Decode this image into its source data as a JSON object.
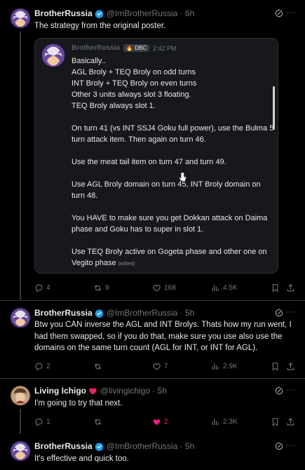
{
  "colors": {
    "background": "#000000",
    "text": "#e7e9ea",
    "muted": "#71767b",
    "verified": "#1d9bf0",
    "like_active": "#f91880",
    "card": "#16181c",
    "border": "#2f3336"
  },
  "tweets": [
    {
      "name": "BrotherRussia",
      "handle": "@ImBrotherRussia · 6h",
      "text": "The strategy from the original poster.",
      "quote": {
        "name": "BrotherRussia",
        "badge": "🔥 DBC",
        "time": "2:42 PM",
        "lines": [
          "Basically..",
          "AGL Broly + TEQ Broly on odd turns",
          "INT Broly + TEQ Broly on even turns",
          "Other 3 units always slot 3 floating.",
          "TEQ Broly always slot 1."
        ],
        "paragraphs": [
          "On turn 41 (vs INT SSJ4 Goku full power), use the Bulma 5 turn attack item. Then again on turn 46.",
          "Use the meat tail item on turn 47 and turn 49.",
          "Use AGL Broly domain on turn 45, INT Broly domain on turn 48.",
          "You HAVE to make sure you get Dokkan attack on Daima phase and Goku has to super in slot 1.",
          "Use TEQ Broly active on Gogeta phase and other one on Vegito phase"
        ],
        "edited": "(edited)"
      },
      "stats": {
        "replies": "4",
        "reposts": "9",
        "likes": "168",
        "views": "4.5K"
      }
    },
    {
      "name": "BrotherRussia",
      "handle": "@ImBrotherRussia · 5h",
      "text": "Btw you CAN inverse the AGL and INT Brolys. Thats how my run went, I had them swapped, so if you do that, make sure you use also use the domains on the same turn count (AGL for INT, or INT for AGL).",
      "stats": {
        "replies": "2",
        "reposts": "",
        "likes": "7",
        "views": "2.9K"
      }
    },
    {
      "name": "Living Ichigo",
      "handle": "@livingichigo · 5h",
      "text": "I'm going to try that next.",
      "stats": {
        "replies": "1",
        "reposts": "",
        "likes": "2",
        "views": "2.3K"
      }
    },
    {
      "name": "BrotherRussia",
      "handle": "@ImBrotherRussia · 5h",
      "text": "It's effective and quick too."
    }
  ],
  "icons": [
    "verified-icon",
    "grok-icon",
    "more-icon",
    "reply-icon",
    "repost-icon",
    "like-icon",
    "views-icon",
    "bookmark-icon",
    "share-icon",
    "heart-emoji-icon"
  ]
}
